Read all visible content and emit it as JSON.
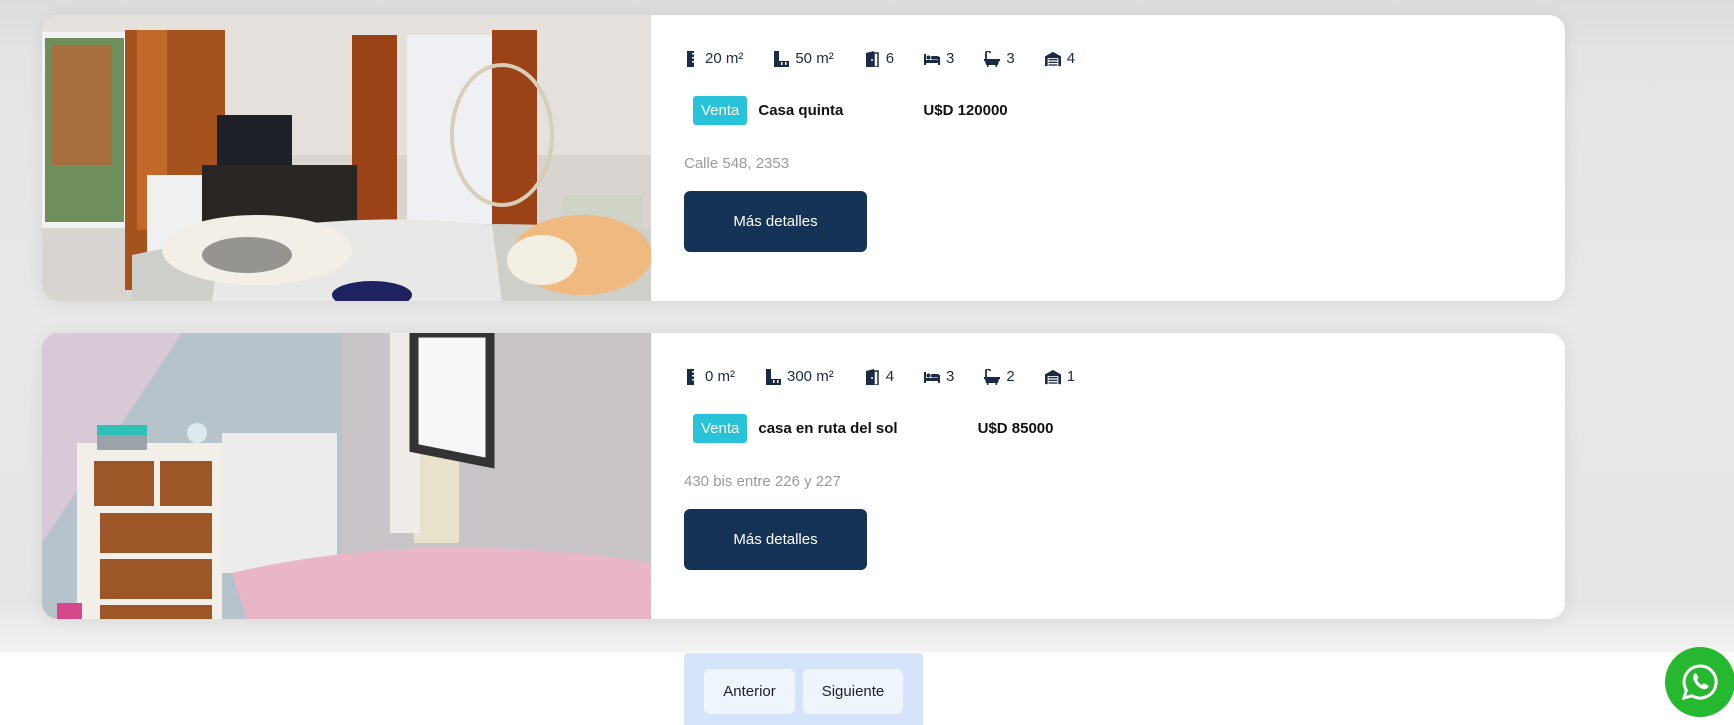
{
  "listings": [
    {
      "features": {
        "covered_area": "20 m²",
        "total_area": "50 m²",
        "rooms": "6",
        "bedrooms": "3",
        "bathrooms": "3",
        "garages": "4"
      },
      "operation": "Venta",
      "type": "Casa quinta",
      "price": "U$D 120000",
      "address": "Calle 548, 2353",
      "button": "Más detalles"
    },
    {
      "features": {
        "covered_area": "0 m²",
        "total_area": "300 m²",
        "rooms": "4",
        "bedrooms": "3",
        "bathrooms": "2",
        "garages": "1"
      },
      "operation": "Venta",
      "type": "casa en ruta del sol",
      "price": "U$D 85000",
      "address": "430 bis entre 226 y 227",
      "button": "Más detalles"
    }
  ],
  "pagination": {
    "previous": "Anterior",
    "next": "Siguiente"
  },
  "colors": {
    "accent_badge": "#29c3d9",
    "button_primary": "#143357",
    "whatsapp": "#26b82e",
    "pager_bg": "#d5e3fb"
  },
  "icons": [
    "ruler-vertical-icon",
    "ruler-combined-icon",
    "door-icon",
    "bed-icon",
    "bath-icon",
    "garage-icon",
    "whatsapp-icon"
  ]
}
